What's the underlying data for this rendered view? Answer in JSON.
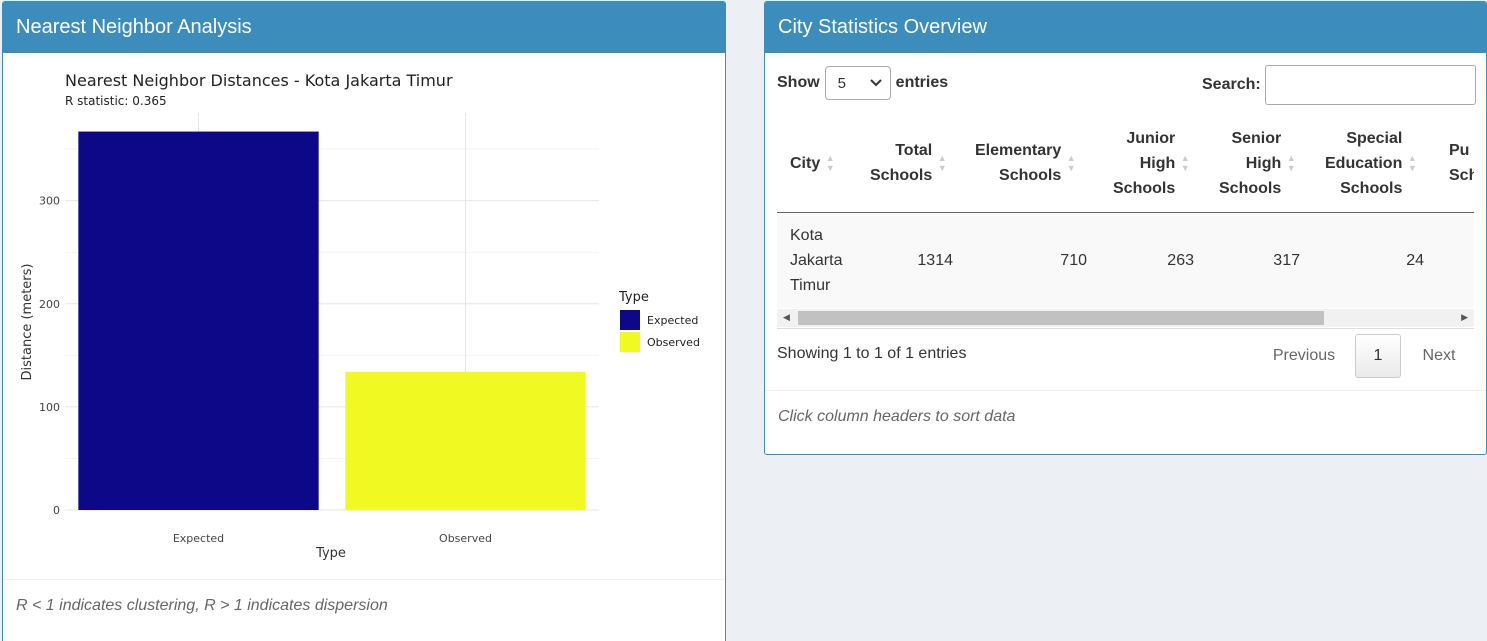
{
  "left_panel": {
    "title": "Nearest Neighbor Analysis",
    "footer_note": "R < 1 indicates clustering, R > 1 indicates dispersion"
  },
  "chart_data": {
    "type": "bar",
    "title": "Nearest Neighbor Distances - Kota Jakarta Timur",
    "subtitle": "R statistic: 0.365",
    "xlabel": "Type",
    "ylabel": "Distance (meters)",
    "categories": [
      "Expected",
      "Observed"
    ],
    "values": [
      367,
      134
    ],
    "colors": [
      "#0D0887",
      "#F0F921"
    ],
    "yticks": [
      0,
      100,
      200,
      300
    ],
    "ylim": [
      0,
      385
    ],
    "grid": true,
    "legend": {
      "title": "Type",
      "placement": "right",
      "entries": [
        "Expected",
        "Observed"
      ]
    }
  },
  "right_panel": {
    "title": "City Statistics Overview",
    "show_label": "Show",
    "entries_label": "entries",
    "length_value": "5",
    "search_label": "Search:",
    "search_value": "",
    "columns": [
      [
        "City"
      ],
      [
        "Total",
        "Schools"
      ],
      [
        "Elementary",
        "Schools"
      ],
      [
        "Junior",
        "High",
        "Schools"
      ],
      [
        "Senior",
        "High",
        "Schools"
      ],
      [
        "Special",
        "Education",
        "Schools"
      ],
      [
        "Pu",
        "Sch"
      ]
    ],
    "rows": [
      {
        "city": [
          "Kota",
          "Jakarta",
          "Timur"
        ],
        "total": "1314",
        "elementary": "710",
        "junior": "263",
        "senior": "317",
        "special": "24"
      }
    ],
    "info": "Showing 1 to 1 of 1 entries",
    "pagination": {
      "previous": "Previous",
      "current": "1",
      "next": "Next"
    },
    "footer_note": "Click column headers to sort data"
  },
  "colors": {
    "header": "#3c8dbc",
    "background": "#ecf0f5"
  }
}
